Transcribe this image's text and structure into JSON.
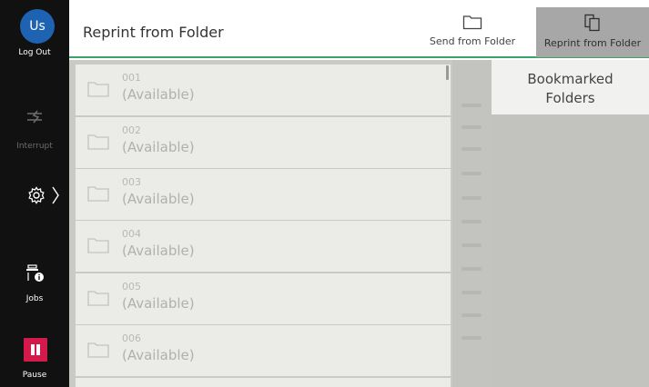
{
  "rail": {
    "avatar_initials": "Us",
    "log_out": "Log Out",
    "interrupt": "Interrupt",
    "jobs": "Jobs",
    "pause": "Pause"
  },
  "header": {
    "title": "Reprint from Folder",
    "tabs": [
      {
        "label": "Send from Folder",
        "icon": "folder-icon"
      },
      {
        "label": "Reprint from Folder",
        "icon": "copy-pages-icon",
        "selected": true
      }
    ]
  },
  "folders": [
    {
      "number": "001",
      "status": "(Available)"
    },
    {
      "number": "002",
      "status": "(Available)"
    },
    {
      "number": "003",
      "status": "(Available)"
    },
    {
      "number": "004",
      "status": "(Available)"
    },
    {
      "number": "005",
      "status": "(Available)"
    },
    {
      "number": "006",
      "status": "(Available)"
    }
  ],
  "right_panel": {
    "bookmark_line1": "Bookmarked",
    "bookmark_line2": "Folders"
  },
  "colors": {
    "accent_green": "#3aa36a",
    "avatar_blue": "#1e63b2",
    "pause_red": "#d31a4a"
  }
}
